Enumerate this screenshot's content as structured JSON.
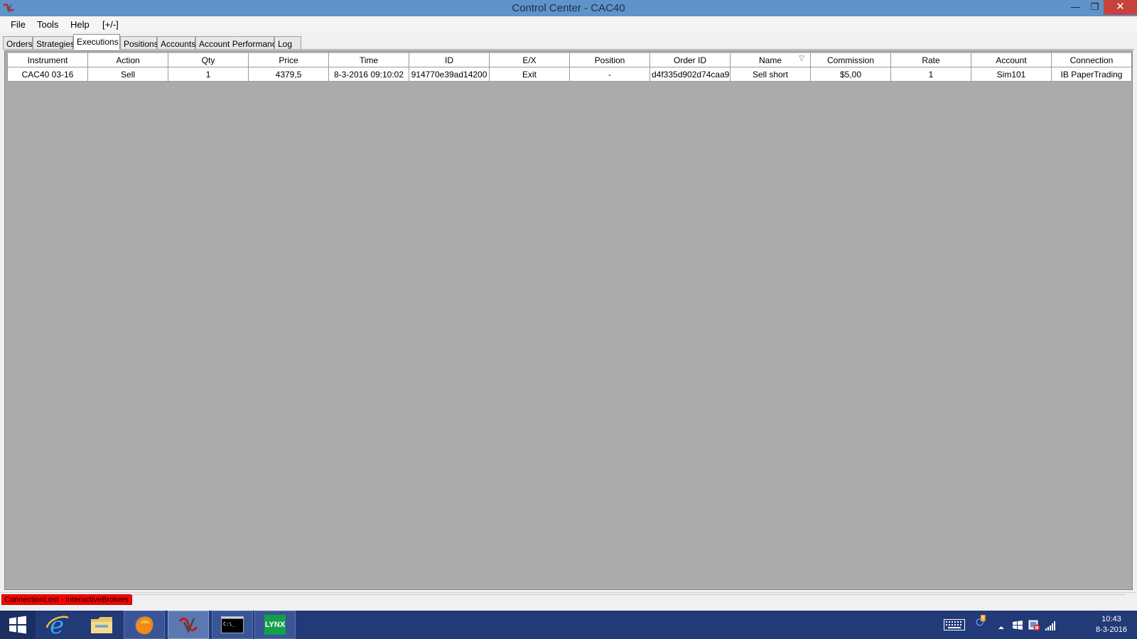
{
  "window": {
    "title": "Control Center - CAC40"
  },
  "menu": {
    "file": "File",
    "tools": "Tools",
    "help": "Help",
    "toggle": "[+/-]"
  },
  "tabs": [
    {
      "label": "Orders",
      "active": false
    },
    {
      "label": "Strategies",
      "active": false
    },
    {
      "label": "Executions",
      "active": true
    },
    {
      "label": "Positions",
      "active": false
    },
    {
      "label": "Accounts",
      "active": false
    },
    {
      "label": "Account Performance",
      "active": false
    },
    {
      "label": "Log",
      "active": false
    }
  ],
  "grid": {
    "columns": [
      "Instrument",
      "Action",
      "Qty",
      "Price",
      "Time",
      "ID",
      "E/X",
      "Position",
      "Order ID",
      "Name",
      "Commission",
      "Rate",
      "Account",
      "Connection"
    ],
    "sorted_column": "Name",
    "rows": [
      [
        "CAC40 03-16",
        "Sell",
        "1",
        "4379,5",
        "8-3-2016 09:10:02",
        "914770e39ad14200",
        "Exit",
        "-",
        "d4f335d902d74caa9",
        "Sell short",
        "$5,00",
        "1",
        "Sim101",
        "IB PaperTrading"
      ]
    ]
  },
  "status": {
    "message": "ConnectionLost - InteractiveBrokers"
  },
  "taskbar": {
    "apps": [
      "start",
      "internet-explorer",
      "file-explorer",
      "firefox",
      "ninjatrader",
      "command-prompt",
      "lynx"
    ],
    "lynx_label": "LYNX",
    "cmd_label": "C:\\_"
  },
  "clock": {
    "time": "10:43",
    "date": "8-3-2016"
  },
  "colors": {
    "titlebar": "#5f93c9",
    "close": "#c7423c",
    "status_error": "#ff0000",
    "taskbar": "#223a78",
    "grid_bg": "#ababab"
  }
}
